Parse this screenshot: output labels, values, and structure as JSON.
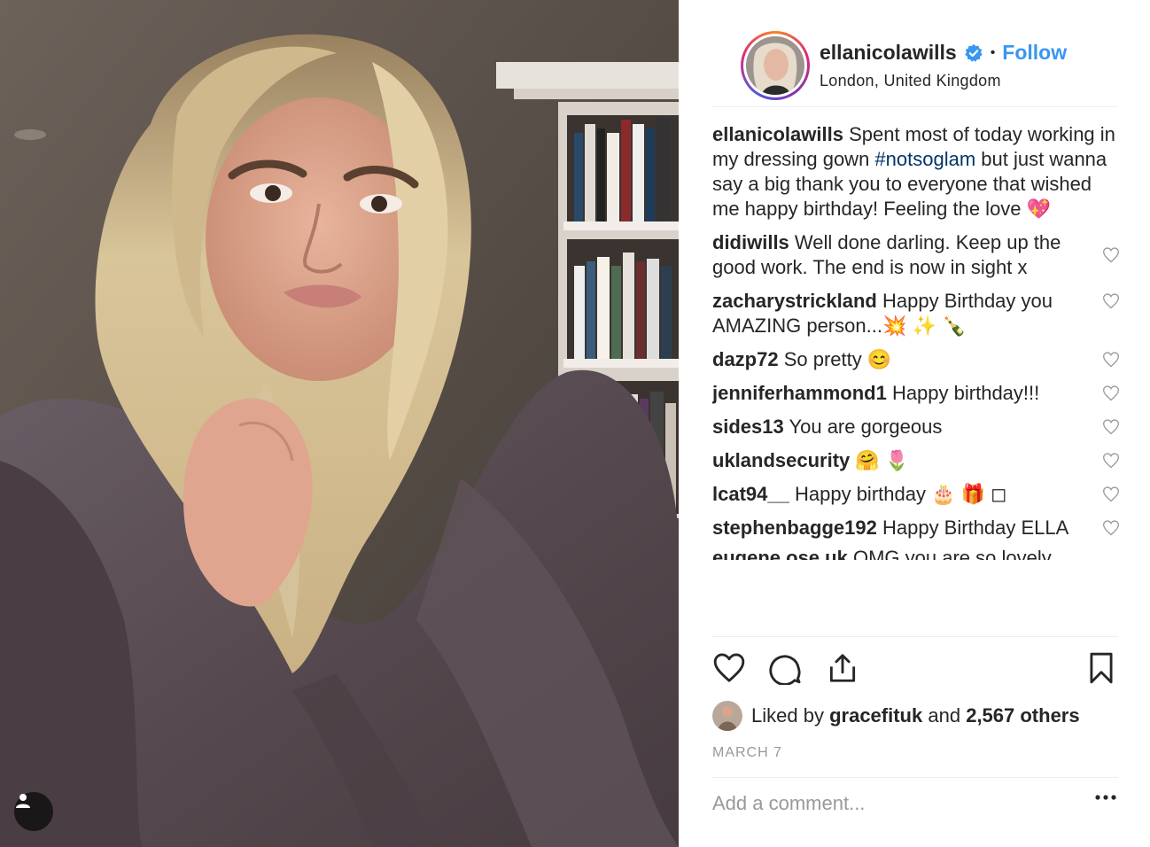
{
  "post": {
    "username": "ellanicolawills",
    "follow_label": "Follow",
    "dot": "•",
    "location": "London, United Kingdom",
    "verified_icon": "verified-badge-icon"
  },
  "caption": {
    "username": "ellanicolawills",
    "text_before": "Spent most of today working in my dressing gown ",
    "hashtag": "#notsoglam",
    "text_after": " but just wanna say a big thank you to everyone that wished me happy birthday! Feeling the love 💖"
  },
  "comments": [
    {
      "username": "didiwills",
      "text": "Well done darling. Keep up the good work. The end is now in sight x"
    },
    {
      "username": "zacharystrickland",
      "text": "Happy Birthday you AMAZING person...💥 ✨ 🍾"
    },
    {
      "username": "dazp72",
      "text": "So pretty 😊"
    },
    {
      "username": "jenniferhammond1",
      "text": "Happy birthday!!!"
    },
    {
      "username": "sides13",
      "text": "You are gorgeous"
    },
    {
      "username": "uklandsecurity",
      "text": "🤗 🌷"
    },
    {
      "username": "lcat94__",
      "text": "Happy birthday 🎂 🎁 ◻"
    },
    {
      "username": "stephenbagge192",
      "text": "Happy Birthday ELLA"
    }
  ],
  "partial_comment": {
    "username": "eugene.ose.uk",
    "text": "OMG you are so lovely"
  },
  "likes": {
    "prefix": "Liked by ",
    "user": "gracefituk",
    "middle": " and ",
    "count": "2,567 others"
  },
  "date": "MARCH 7",
  "add_comment": {
    "placeholder": "Add a comment..."
  },
  "colors": {
    "accent": "#3897f0",
    "hashtag": "#003569",
    "muted": "#999999",
    "divider": "#efefef"
  }
}
